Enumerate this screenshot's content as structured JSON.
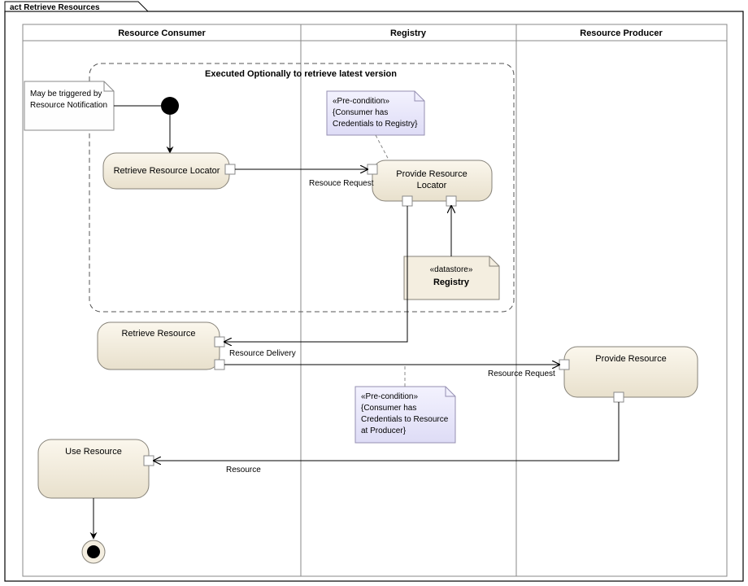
{
  "diagram": {
    "title": "act Retrieve Resources",
    "lanes": {
      "consumer": "Resource Consumer",
      "registry": "Registry",
      "producer": "Resource Producer"
    },
    "region": {
      "label": "Executed Optionally to retrieve latest version"
    },
    "notes": {
      "trigger": {
        "line1": "May be triggered by",
        "line2": "Resource Notification"
      },
      "preRegistry": {
        "stereo": "«Pre-condition»",
        "line1": "{Consumer has",
        "line2": "Credentials to Registry}"
      },
      "preProducer": {
        "stereo": "«Pre-condition»",
        "line1": "{Consumer has",
        "line2": "Credentials to Resource",
        "line3": "at Producer}"
      }
    },
    "activities": {
      "retrieveLocator": "Retrieve Resource Locator",
      "provideLocator": {
        "line1": "Provide Resource",
        "line2": "Locator"
      },
      "retrieveResource": "Retrieve Resource",
      "provideResource": "Provide Resource",
      "useResource": "Use Resource"
    },
    "datastore": {
      "stereo": "«datastore»",
      "name": "Registry"
    },
    "flowLabels": {
      "resourceRequest1": "Resouce Request",
      "resourceDelivery": "Resource Delivery",
      "resourceRequest2": "Resource Request",
      "resource": "Resource"
    }
  },
  "chart_data": {
    "type": "table",
    "title": "UML Activity Diagram: Retrieve Resources",
    "swimlanes": [
      "Resource Consumer",
      "Registry",
      "Resource Producer"
    ],
    "nodes": [
      {
        "id": "initial",
        "type": "initial",
        "lane": "Resource Consumer"
      },
      {
        "id": "retrieveLocator",
        "type": "activity",
        "lane": "Resource Consumer",
        "label": "Retrieve Resource Locator"
      },
      {
        "id": "provideLocator",
        "type": "activity",
        "lane": "Registry",
        "label": "Provide Resource Locator"
      },
      {
        "id": "registryStore",
        "type": "datastore",
        "lane": "Registry",
        "label": "Registry"
      },
      {
        "id": "retrieveResource",
        "type": "activity",
        "lane": "Resource Consumer",
        "label": "Retrieve Resource"
      },
      {
        "id": "provideResource",
        "type": "activity",
        "lane": "Resource Producer",
        "label": "Provide Resource"
      },
      {
        "id": "useResource",
        "type": "activity",
        "lane": "Resource Consumer",
        "label": "Use Resource"
      },
      {
        "id": "final",
        "type": "final",
        "lane": "Resource Consumer"
      }
    ],
    "edges": [
      {
        "from": "initial",
        "to": "retrieveLocator",
        "type": "control"
      },
      {
        "from": "retrieveLocator",
        "to": "provideLocator",
        "type": "object",
        "label": "Resouce Request"
      },
      {
        "from": "registryStore",
        "to": "provideLocator",
        "type": "object"
      },
      {
        "from": "provideLocator",
        "to": "retrieveResource",
        "type": "object",
        "label": "Resource Delivery"
      },
      {
        "from": "retrieveResource",
        "to": "provideResource",
        "type": "object",
        "label": "Resource Request"
      },
      {
        "from": "provideResource",
        "to": "useResource",
        "type": "object",
        "label": "Resource"
      },
      {
        "from": "useResource",
        "to": "final",
        "type": "control"
      }
    ],
    "notes": [
      {
        "attachedTo": "initial",
        "text": "May be triggered by Resource Notification"
      },
      {
        "attachedTo": "provideLocator",
        "text": "«Pre-condition» {Consumer has Credentials to Registry}"
      },
      {
        "attachedTo": "provideResource",
        "text": "«Pre-condition» {Consumer has Credentials to Resource at Producer}"
      }
    ],
    "region": {
      "label": "Executed Optionally to retrieve latest version",
      "contains": [
        "initial",
        "retrieveLocator",
        "provideLocator",
        "registryStore"
      ]
    }
  }
}
